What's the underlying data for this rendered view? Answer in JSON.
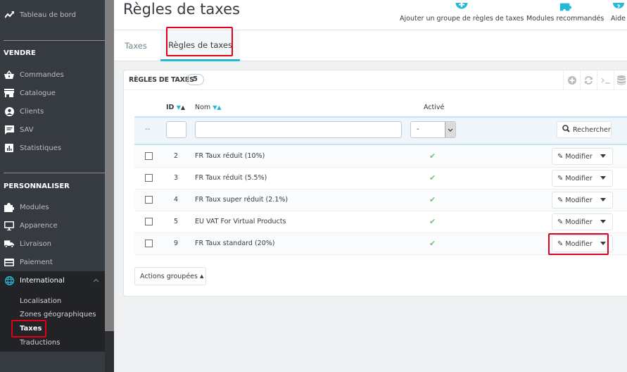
{
  "sidebar": {
    "dashboard": "Tableau de bord",
    "sections": {
      "sell": "VENDRE",
      "customize": "PERSONNALISER"
    },
    "sell_items": [
      {
        "label": "Commandes",
        "icon": "basket-icon"
      },
      {
        "label": "Catalogue",
        "icon": "store-icon"
      },
      {
        "label": "Clients",
        "icon": "user-circle-icon"
      },
      {
        "label": "SAV",
        "icon": "chat-icon"
      },
      {
        "label": "Statistiques",
        "icon": "stats-icon"
      }
    ],
    "customize_items": [
      {
        "label": "Modules",
        "icon": "puzzle-icon"
      },
      {
        "label": "Apparence",
        "icon": "monitor-icon"
      },
      {
        "label": "Livraison",
        "icon": "truck-icon"
      },
      {
        "label": "Paiement",
        "icon": "credit-card-icon"
      }
    ],
    "international": {
      "label": "International",
      "icon": "globe-icon",
      "subitems": [
        "Localisation",
        "Zones géographiques",
        "Taxes",
        "Traductions"
      ],
      "active_subitem": "Taxes"
    }
  },
  "header": {
    "title": "Règles de taxes",
    "toolbar": [
      {
        "label": "Ajouter un groupe de règles de taxes",
        "icon": "plus-circle-icon"
      },
      {
        "label": "Modules recommandés",
        "icon": "puzzle-icon"
      },
      {
        "label": "Aide",
        "icon": "help-icon"
      }
    ]
  },
  "tabs": [
    {
      "label": "Taxes",
      "active": false
    },
    {
      "label": "Règles de taxes",
      "active": true
    }
  ],
  "panel": {
    "title": "RÈGLES DE TAXES",
    "count": "5",
    "columns": {
      "id": "ID",
      "name": "Nom",
      "active": "Activé"
    },
    "filters": {
      "dash": "--",
      "id_value": "",
      "name_value": "",
      "active_value": "-",
      "search_label": "Rechercher"
    },
    "rows": [
      {
        "id": "2",
        "name": "FR Taux réduit (10%)",
        "active": true,
        "action": "Modifier"
      },
      {
        "id": "3",
        "name": "FR Taux réduit (5.5%)",
        "active": true,
        "action": "Modifier"
      },
      {
        "id": "4",
        "name": "FR Taux super réduit (2.1%)",
        "active": true,
        "action": "Modifier"
      },
      {
        "id": "5",
        "name": "EU VAT For Virtual Products",
        "active": true,
        "action": "Modifier"
      },
      {
        "id": "9",
        "name": "FR Taux standard (20%)",
        "active": true,
        "action": "Modifier"
      }
    ],
    "bulk_actions": "Actions groupées"
  },
  "colors": {
    "accent": "#25b9d7",
    "highlight": "#e3001b",
    "success": "#72c279",
    "sidebar_bg": "#363a41"
  }
}
